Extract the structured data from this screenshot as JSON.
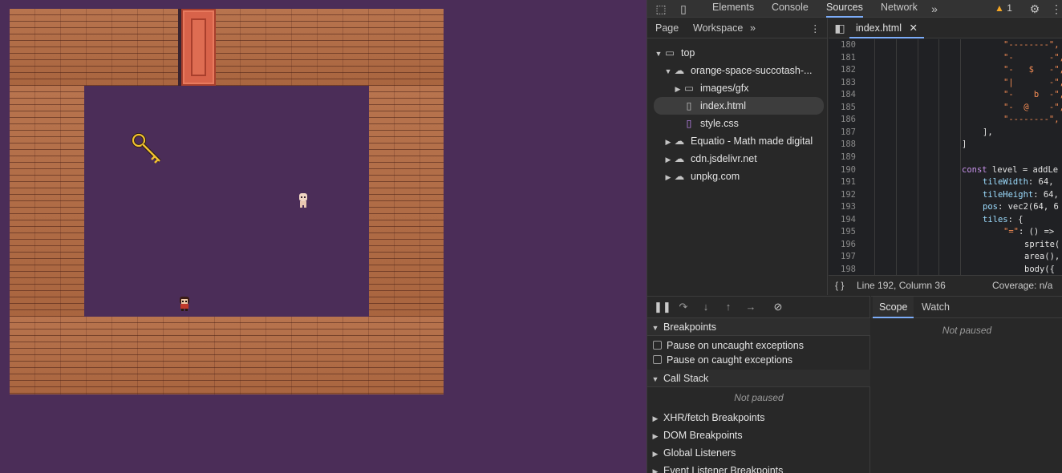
{
  "devtools": {
    "tabs": [
      "Elements",
      "Console",
      "Sources",
      "Network"
    ],
    "active_tab": "Sources",
    "warning_count": "1",
    "navigator": {
      "tabs": [
        "Page",
        "Workspace"
      ],
      "tree": [
        {
          "label": "top"
        },
        {
          "label": "orange-space-succotash-..."
        },
        {
          "label": "images/gfx"
        },
        {
          "label": "index.html"
        },
        {
          "label": "style.css"
        },
        {
          "label": "Equatio - Math made digital"
        },
        {
          "label": "cdn.jsdelivr.net"
        },
        {
          "label": "unpkg.com"
        }
      ]
    },
    "editor": {
      "file_tab": "index.html",
      "lines": [
        {
          "n": "180",
          "code": "\"--------\","
        },
        {
          "n": "181",
          "code": "\"-       -\","
        },
        {
          "n": "182",
          "code": "\"-   $   -\","
        },
        {
          "n": "183",
          "code": "\"|       -\","
        },
        {
          "n": "184",
          "code": "\"-    b  -\","
        },
        {
          "n": "185",
          "code": "\"-  @    -\","
        },
        {
          "n": "186",
          "code": "\"--------\","
        },
        {
          "n": "187",
          "code": "],"
        },
        {
          "n": "188",
          "code": "]"
        },
        {
          "n": "189",
          "code": ""
        },
        {
          "n": "190",
          "code_kw": "const",
          "code_rest": " level = addLe"
        },
        {
          "n": "191",
          "code_prop": "tileWidth",
          "code_rest": ": 64,"
        },
        {
          "n": "192",
          "code_prop": "tileHeight",
          "code_rest": ": 64,"
        },
        {
          "n": "193",
          "code_prop": "pos",
          "code_rest": ": vec2(64, 6"
        },
        {
          "n": "194",
          "code_prop": "tiles",
          "code_rest": ": {"
        },
        {
          "n": "195",
          "code_str": "\"=\"",
          "code_rest": ": () =>"
        },
        {
          "n": "196",
          "code": "sprite("
        },
        {
          "n": "197",
          "code": "area(),"
        },
        {
          "n": "198",
          "code": "body({"
        }
      ],
      "status": "Line 192, Column 36",
      "coverage": "Coverage: n/a"
    },
    "debugger": {
      "breakpoints_label": "Breakpoints",
      "uncaught_label": "Pause on uncaught exceptions",
      "caught_label": "Pause on caught exceptions",
      "call_stack_label": "Call Stack",
      "not_paused": "Not paused",
      "sections": [
        "XHR/fetch Breakpoints",
        "DOM Breakpoints",
        "Global Listeners",
        "Event Listener Breakpoints"
      ]
    },
    "scope": {
      "tabs": [
        "Scope",
        "Watch"
      ],
      "not_paused": "Not paused"
    }
  },
  "colors": {
    "game_bg": "#4b2d58",
    "wood": "#b5714d",
    "door": "#d8634a",
    "devtools_bg": "#282828",
    "accent": "#7cacf8"
  }
}
